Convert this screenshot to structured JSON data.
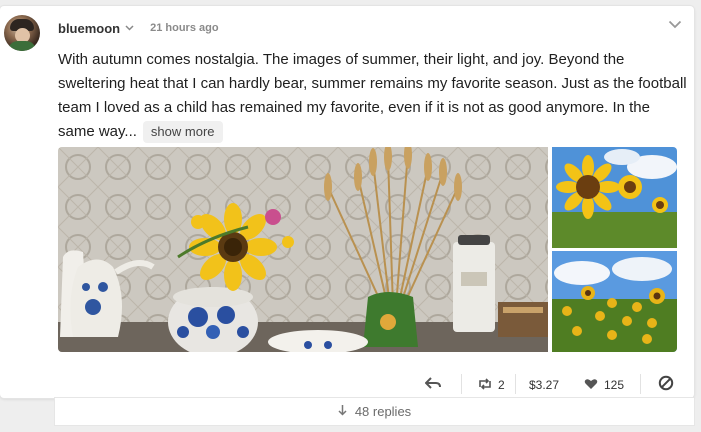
{
  "post": {
    "username": "bluemoon",
    "timestamp": "21 hours ago",
    "body": "With autumn comes nostalgia. The images of summer, their light, and joy. Beyond the sweltering heat that I can hardly bear, summer remains my favorite season. Just as the football team I loved as a child has remained my favorite, even if it is not as good anymore. In the same way...",
    "show_more": "show more",
    "images": [
      {
        "subject": "sunflowers-and-wheat-in-blue-vases"
      },
      {
        "subject": "sunflower-closeup"
      },
      {
        "subject": "sunflower-field"
      }
    ]
  },
  "actions": {
    "reply_icon": "reply-arrow-icon",
    "reblog_icon": "reblog-icon",
    "reblog_count": "2",
    "value": "$3.27",
    "like_icon": "heart-icon",
    "like_count": "125",
    "mute_icon": "block-icon"
  },
  "replies": {
    "label": "48 replies"
  },
  "colors": {
    "background": "#eeeeee",
    "card": "#ffffff",
    "muted_text": "#8a8a8a"
  }
}
